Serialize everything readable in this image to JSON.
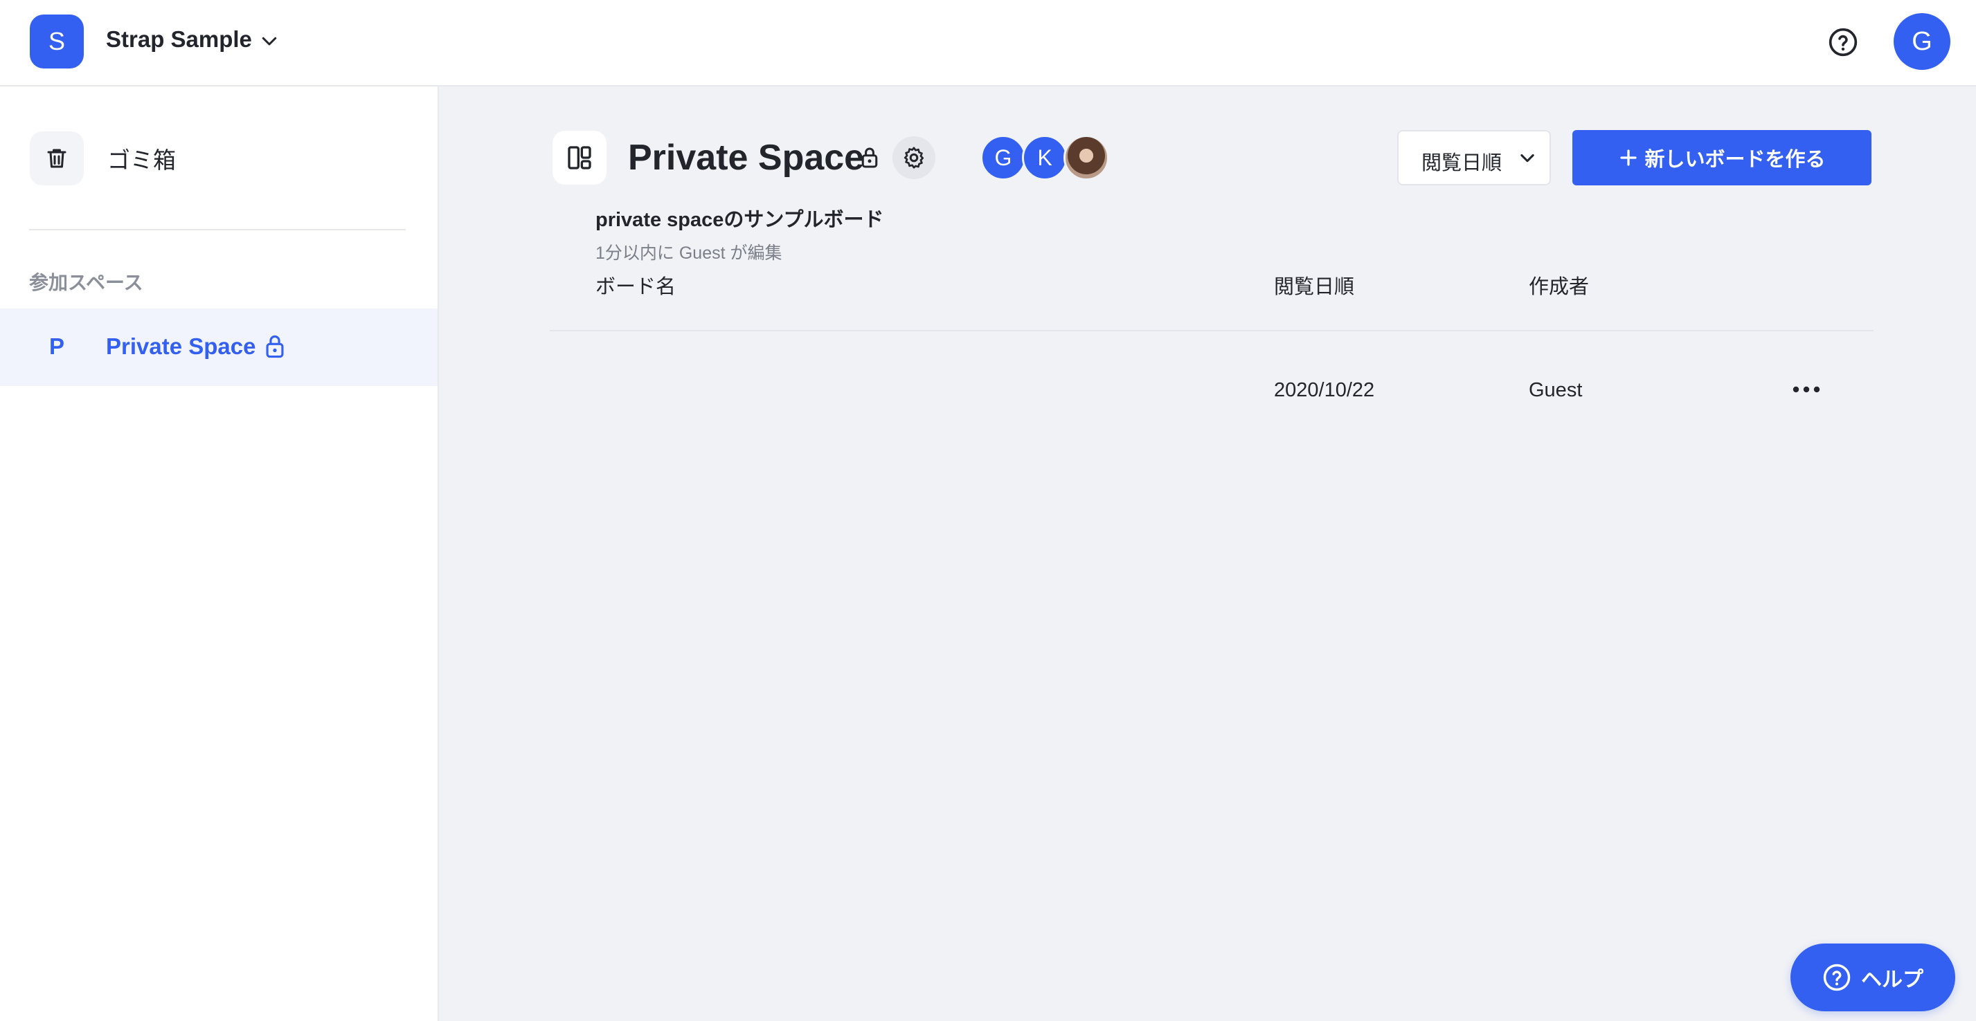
{
  "workspace": {
    "initial": "S",
    "name": "Strap Sample"
  },
  "header": {
    "user_initial": "G"
  },
  "sidebar": {
    "trash_label": "ゴミ箱",
    "section_label": "参加スペース",
    "spaces": [
      {
        "initial": "P",
        "name": "Private Space",
        "private": true
      }
    ]
  },
  "main": {
    "title": "Private Space",
    "members": [
      {
        "initial": "G"
      },
      {
        "initial": "K"
      },
      {
        "initial": ""
      }
    ],
    "sort_label": "閲覧日順",
    "new_board_label": "新しいボードを作る",
    "table": {
      "headers": {
        "name": "ボード名",
        "date": "閲覧日順",
        "author": "作成者"
      },
      "rows": [
        {
          "title": "private spaceのサンプルボード",
          "subtitle": "1分以内に Guest が編集",
          "date": "2020/10/22",
          "author": "Guest"
        }
      ]
    }
  },
  "help_fab_label": "ヘルプ",
  "colors": {
    "accent": "#3360f0",
    "main_bg": "#f1f2f6",
    "selected_bg": "#f2f4fd"
  }
}
